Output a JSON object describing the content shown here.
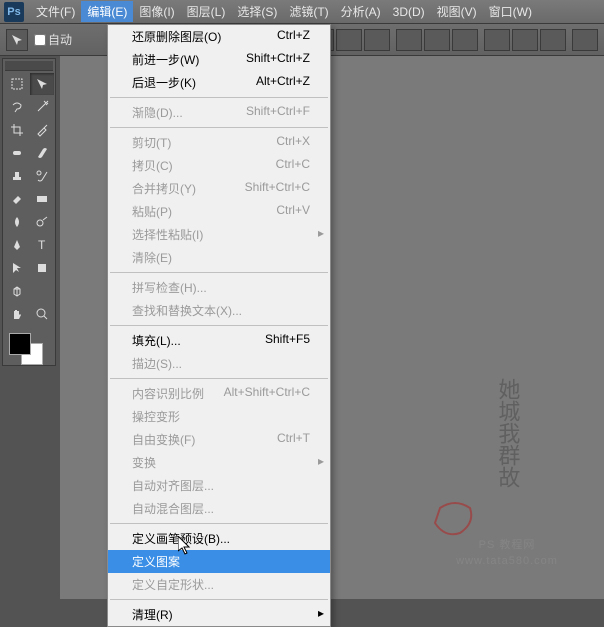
{
  "menubar": {
    "items": [
      "文件(F)",
      "编辑(E)",
      "图像(I)",
      "图层(L)",
      "选择(S)",
      "滤镜(T)",
      "分析(A)",
      "3D(D)",
      "视图(V)",
      "窗口(W)"
    ]
  },
  "optionsbar": {
    "auto_label": "自动"
  },
  "dropdown": {
    "items": [
      {
        "label": "还原删除图层(O)",
        "shortcut": "Ctrl+Z",
        "enabled": true
      },
      {
        "label": "前进一步(W)",
        "shortcut": "Shift+Ctrl+Z",
        "enabled": true
      },
      {
        "label": "后退一步(K)",
        "shortcut": "Alt+Ctrl+Z",
        "enabled": true
      },
      {
        "sep": true
      },
      {
        "label": "渐隐(D)...",
        "shortcut": "Shift+Ctrl+F",
        "enabled": false
      },
      {
        "sep": true
      },
      {
        "label": "剪切(T)",
        "shortcut": "Ctrl+X",
        "enabled": false
      },
      {
        "label": "拷贝(C)",
        "shortcut": "Ctrl+C",
        "enabled": false
      },
      {
        "label": "合并拷贝(Y)",
        "shortcut": "Shift+Ctrl+C",
        "enabled": false
      },
      {
        "label": "粘贴(P)",
        "shortcut": "Ctrl+V",
        "enabled": false
      },
      {
        "label": "选择性粘贴(I)",
        "shortcut": "",
        "enabled": false,
        "submenu": true
      },
      {
        "label": "清除(E)",
        "shortcut": "",
        "enabled": false
      },
      {
        "sep": true
      },
      {
        "label": "拼写检查(H)...",
        "shortcut": "",
        "enabled": false
      },
      {
        "label": "查找和替换文本(X)...",
        "shortcut": "",
        "enabled": false
      },
      {
        "sep": true
      },
      {
        "label": "填充(L)...",
        "shortcut": "Shift+F5",
        "enabled": true
      },
      {
        "label": "描边(S)...",
        "shortcut": "",
        "enabled": false
      },
      {
        "sep": true
      },
      {
        "label": "内容识别比例",
        "shortcut": "Alt+Shift+Ctrl+C",
        "enabled": false
      },
      {
        "label": "操控变形",
        "shortcut": "",
        "enabled": false
      },
      {
        "label": "自由变换(F)",
        "shortcut": "Ctrl+T",
        "enabled": false
      },
      {
        "label": "变换",
        "shortcut": "",
        "enabled": false,
        "submenu": true
      },
      {
        "label": "自动对齐图层...",
        "shortcut": "",
        "enabled": false
      },
      {
        "label": "自动混合图层...",
        "shortcut": "",
        "enabled": false
      },
      {
        "sep": true
      },
      {
        "label": "定义画笔预设(B)...",
        "shortcut": "",
        "enabled": true
      },
      {
        "label": "定义图案",
        "shortcut": "",
        "enabled": true,
        "highlighted": true
      },
      {
        "label": "定义自定形状...",
        "shortcut": "",
        "enabled": false
      },
      {
        "sep": true
      },
      {
        "label": "清理(R)",
        "shortcut": "",
        "enabled": true,
        "submenu": true
      }
    ]
  },
  "watermark": {
    "main": "她城我群故",
    "sub1": "PS 教程网",
    "sub2": "www.tata580.com"
  }
}
